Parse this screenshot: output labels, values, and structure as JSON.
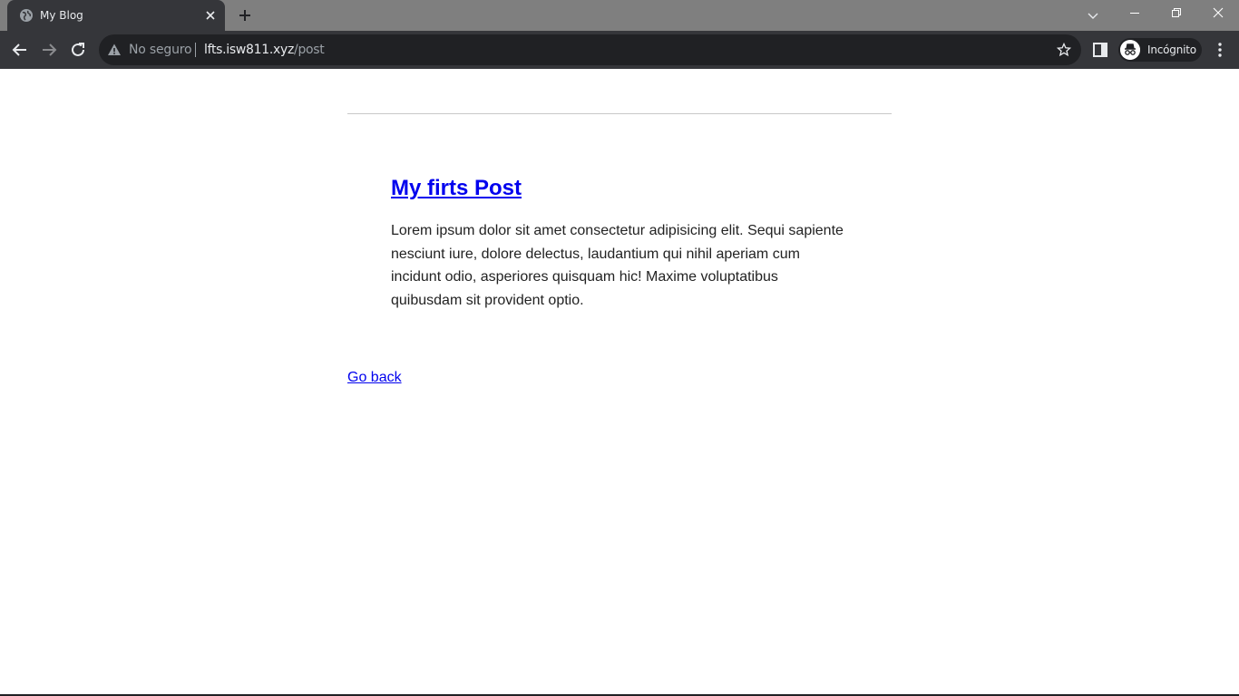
{
  "browser": {
    "tab": {
      "title": "My Blog",
      "favicon": "globe-icon"
    },
    "omnibox": {
      "security_label": "No seguro",
      "url_host": "lfts.isw811.xyz",
      "url_path": "/post"
    },
    "profile_label": "Incógnito",
    "icons": {
      "back": "arrow-left-icon",
      "forward": "arrow-right-icon",
      "reload": "reload-icon",
      "warning": "warning-icon",
      "bookmark": "star-icon",
      "side_panel": "side-panel-icon",
      "menu": "kebab-menu-icon",
      "tab_search": "chevron-down-icon",
      "minimize": "minimize-icon",
      "restore": "restore-icon",
      "close": "close-icon"
    }
  },
  "page": {
    "post": {
      "title": "My firts Post",
      "body": "Lorem ipsum dolor sit amet consectetur adipisicing elit. Sequi sapiente nesciunt iure, dolore delectus, laudantium qui nihil aperiam cum incidunt odio, asperiores quisquam hic! Maxime voluptatibus quibusdam sit provident optio."
    },
    "back_link": "Go back"
  },
  "colors": {
    "link": "#0000ee",
    "chrome_dark": "#35363a",
    "omnibox_bg": "#202124",
    "tabstrip_bg": "#7f7f7f"
  }
}
